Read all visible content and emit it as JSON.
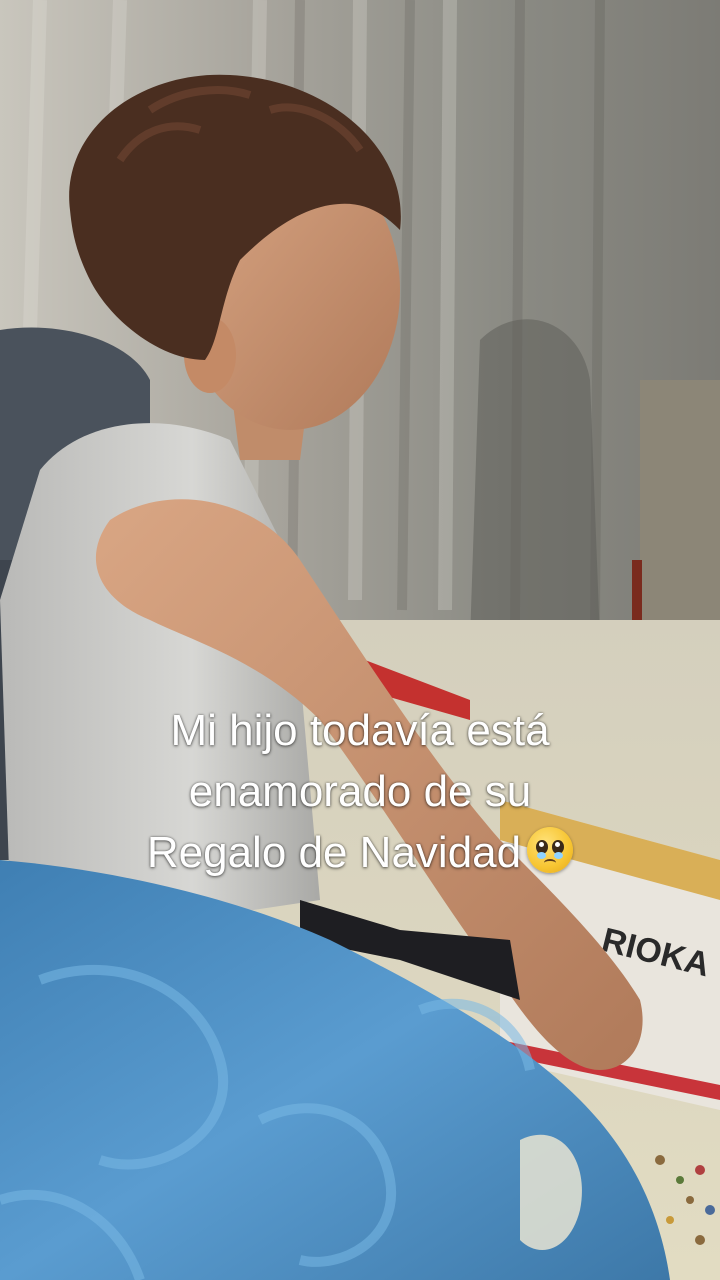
{
  "caption": {
    "line1": "Mi hijo todavía está",
    "line2": "enamorado de su",
    "line3": "Regalo de Navidad",
    "emoji_name": "pleading-face-emoji"
  },
  "box_print": "RIOKA",
  "colors": {
    "caption_text": "#ffffff",
    "blanket": "#4f8fc0",
    "tank_top": "#c9c9c9",
    "curtain": "#a8a69f"
  }
}
